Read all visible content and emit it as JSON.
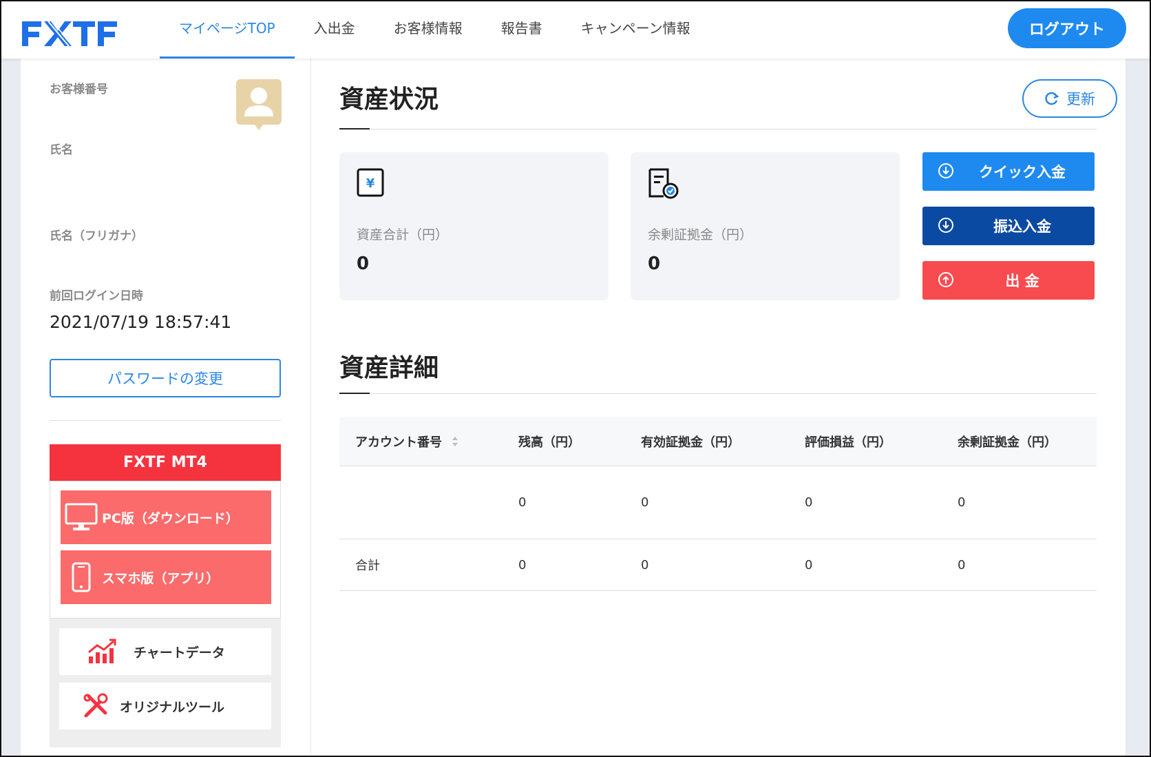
{
  "header": {
    "logo": "FXTF",
    "nav": [
      {
        "label": "マイページTOP",
        "active": true
      },
      {
        "label": "入出金",
        "active": false
      },
      {
        "label": "お客様情報",
        "active": false
      },
      {
        "label": "報告書",
        "active": false
      },
      {
        "label": "キャンペーン情報",
        "active": false
      }
    ],
    "logout_label": "ログアウト"
  },
  "sidebar": {
    "customer_number_label": "お客様番号",
    "name_label": "氏名",
    "name_kana_label": "氏名（フリガナ）",
    "last_login_label": "前回ログイン日時",
    "last_login_value": "2021/07/19 18:57:41",
    "password_change_label": "パスワードの変更",
    "mt4": {
      "title": "FXTF MT4",
      "pc_download_label": "PC版（ダウンロード）",
      "smartphone_label": "スマホ版（アプリ）"
    },
    "tools": {
      "chart_data_label": "チャートデータ",
      "original_tool_label": "オリジナルツール"
    }
  },
  "asset_status": {
    "title": "資産状況",
    "refresh_label": "更新",
    "total_assets_label": "資産合計（円）",
    "total_assets_value": "0",
    "free_margin_label": "余剰証拠金（円）",
    "free_margin_value": "0",
    "quick_deposit_label": "クイック入金",
    "transfer_deposit_label": "振込入金",
    "withdraw_label": "出 金",
    "colors": {
      "quick": "#1e8af0",
      "transfer": "#0b4aa2",
      "withdraw": "#f74b50"
    }
  },
  "asset_detail": {
    "title": "資産詳細",
    "columns": [
      "アカウント番号",
      "残高（円）",
      "有効証拠金（円）",
      "評価損益（円）",
      "余剰証拠金（円）"
    ],
    "rows": [
      [
        "",
        "0",
        "0",
        "0",
        "0"
      ]
    ],
    "total_row": [
      "合計",
      "0",
      "0",
      "0",
      "0"
    ]
  }
}
